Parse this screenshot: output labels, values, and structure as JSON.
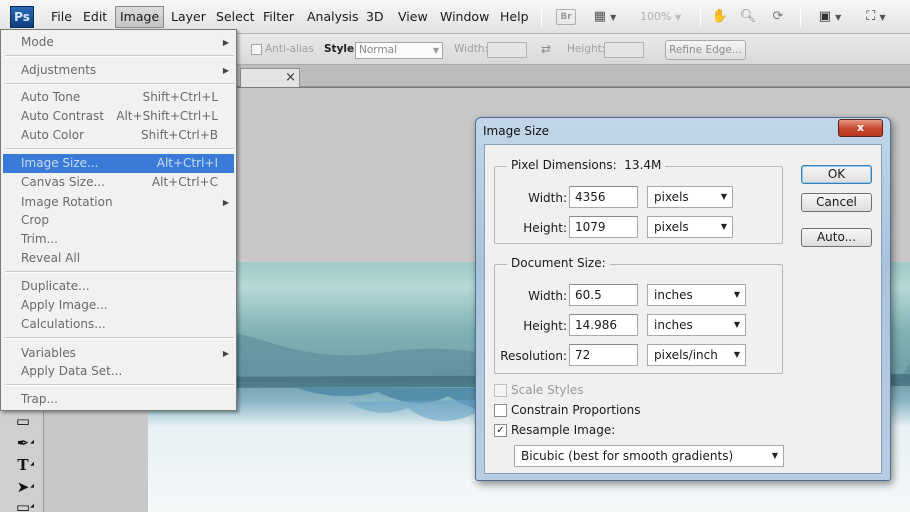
{
  "app": {
    "logo": "Ps"
  },
  "menubar": {
    "items": [
      "File",
      "Edit",
      "Image",
      "Layer",
      "Select",
      "Filter",
      "Analysis",
      "3D",
      "View",
      "Window",
      "Help"
    ],
    "bridge_label": "Br",
    "zoom_level": "100%"
  },
  "options_bar": {
    "anti_alias_label": "Anti-alias",
    "style_label": "Style:",
    "style_value": "Normal",
    "width_label": "Width:",
    "height_label": "Height:",
    "refine_edge_label": "Refine Edge..."
  },
  "doc_tab": {
    "close_glyph": "×"
  },
  "image_menu": {
    "mode": "Mode",
    "adjustments": "Adjustments",
    "auto_tone": "Auto Tone",
    "auto_tone_sc": "Shift+Ctrl+L",
    "auto_contrast": "Auto Contrast",
    "auto_contrast_sc": "Alt+Shift+Ctrl+L",
    "auto_color": "Auto Color",
    "auto_color_sc": "Shift+Ctrl+B",
    "image_size": "Image Size...",
    "image_size_sc": "Alt+Ctrl+I",
    "canvas_size": "Canvas Size...",
    "canvas_size_sc": "Alt+Ctrl+C",
    "image_rotation": "Image Rotation",
    "crop": "Crop",
    "trim": "Trim...",
    "reveal_all": "Reveal All",
    "duplicate": "Duplicate...",
    "apply_image": "Apply Image...",
    "calculations": "Calculations...",
    "variables": "Variables",
    "apply_data_set": "Apply Data Set...",
    "trap": "Trap..."
  },
  "dialog": {
    "title": "Image Size",
    "close_glyph": "x",
    "pixel_dimensions": {
      "title": "Pixel Dimensions:",
      "size": "13.4M",
      "width_label": "Width:",
      "width_value": "4356",
      "width_unit": "pixels",
      "height_label": "Height:",
      "height_value": "1079",
      "height_unit": "pixels"
    },
    "document_size": {
      "title": "Document Size:",
      "width_label": "Width:",
      "width_value": "60.5",
      "width_unit": "inches",
      "height_label": "Height:",
      "height_value": "14.986",
      "height_unit": "inches",
      "resolution_label": "Resolution:",
      "resolution_value": "72",
      "resolution_unit": "pixels/inch"
    },
    "ok_label": "OK",
    "cancel_label": "Cancel",
    "auto_label": "Auto...",
    "scale_styles_label": "Scale Styles",
    "scale_styles_checked": false,
    "constrain_label": "Constrain Proportions",
    "constrain_checked": false,
    "resample_label": "Resample Image:",
    "resample_checked": true,
    "check_glyph": "✓",
    "resample_method": "Bicubic (best for smooth gradients)"
  }
}
